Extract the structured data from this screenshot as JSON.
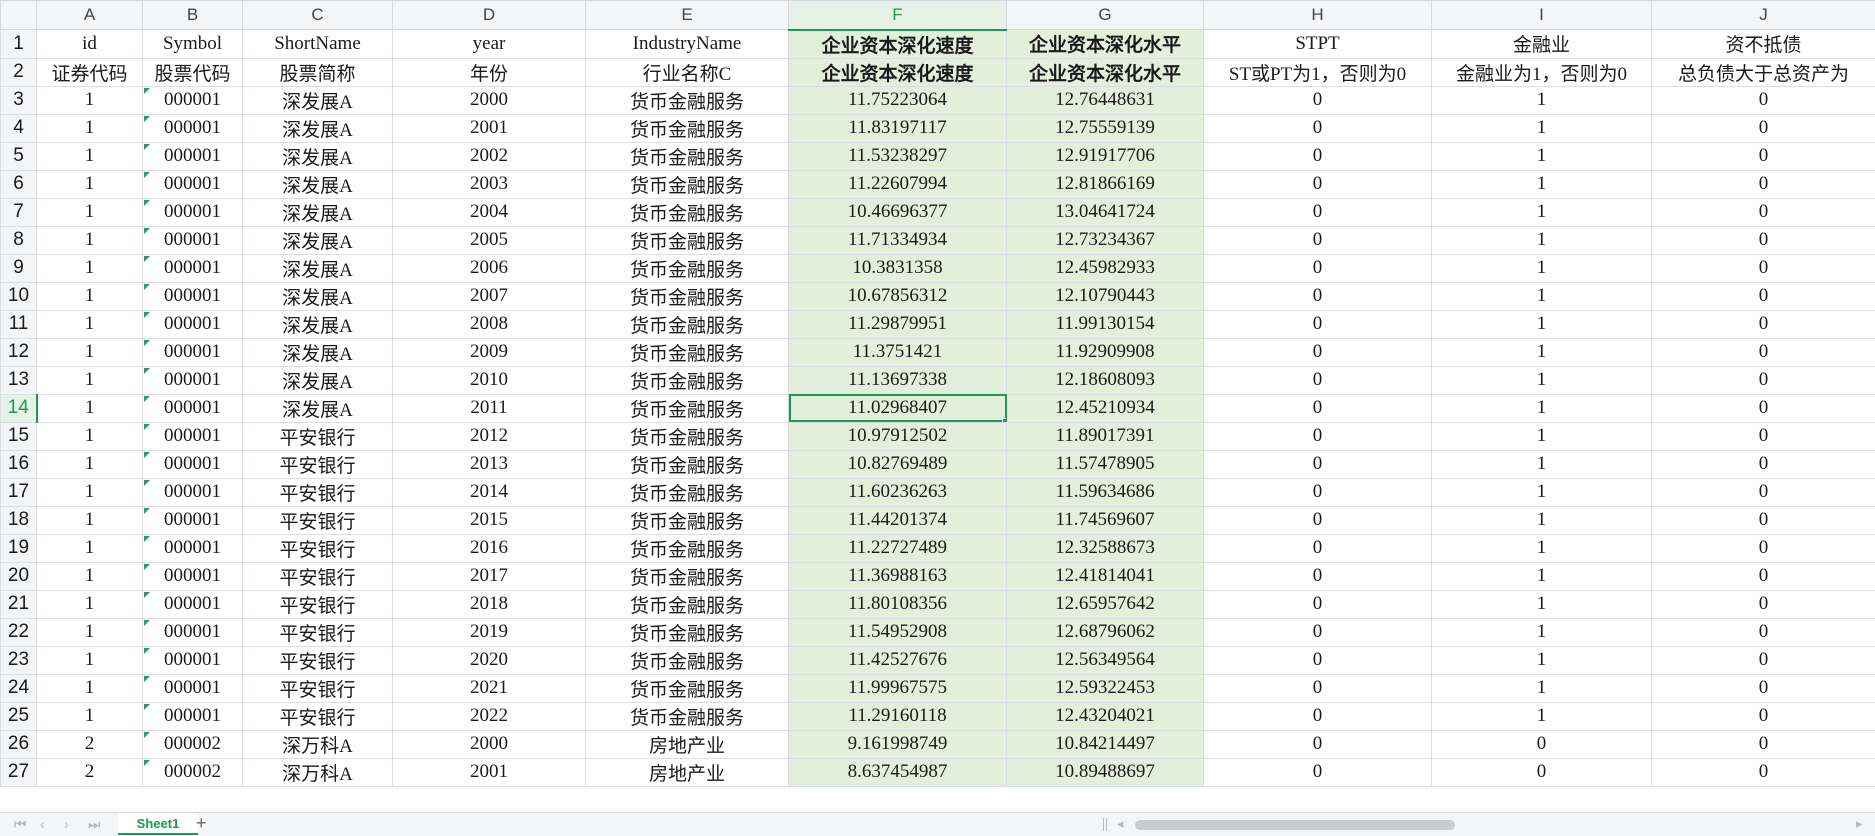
{
  "colors": {
    "accent": "#1e9a4f",
    "highlight": "#e2efda",
    "header_bg": "#f4f5f7"
  },
  "active_cell": "F14",
  "columns": [
    "A",
    "B",
    "C",
    "D",
    "E",
    "F",
    "G",
    "H",
    "I",
    "J"
  ],
  "rows": [
    [
      "1",
      "id",
      "Symbol",
      "ShortName",
      "year",
      "IndustryName",
      "企业资本深化速度",
      "企业资本深化水平",
      "STPT",
      "金融业",
      "资不抵债"
    ],
    [
      "2",
      "证券代码",
      "股票代码",
      "股票简称",
      "年份",
      "行业名称C",
      "企业资本深化速度",
      "企业资本深化水平",
      "ST或PT为1，否则为0",
      "金融业为1，否则为0",
      "总负债大于总资产为"
    ],
    [
      "3",
      "1",
      "000001",
      "深发展A",
      "2000",
      "货币金融服务",
      "11.75223064",
      "12.76448631",
      "0",
      "1",
      "0"
    ],
    [
      "4",
      "1",
      "000001",
      "深发展A",
      "2001",
      "货币金融服务",
      "11.83197117",
      "12.75559139",
      "0",
      "1",
      "0"
    ],
    [
      "5",
      "1",
      "000001",
      "深发展A",
      "2002",
      "货币金融服务",
      "11.53238297",
      "12.91917706",
      "0",
      "1",
      "0"
    ],
    [
      "6",
      "1",
      "000001",
      "深发展A",
      "2003",
      "货币金融服务",
      "11.22607994",
      "12.81866169",
      "0",
      "1",
      "0"
    ],
    [
      "7",
      "1",
      "000001",
      "深发展A",
      "2004",
      "货币金融服务",
      "10.46696377",
      "13.04641724",
      "0",
      "1",
      "0"
    ],
    [
      "8",
      "1",
      "000001",
      "深发展A",
      "2005",
      "货币金融服务",
      "11.71334934",
      "12.73234367",
      "0",
      "1",
      "0"
    ],
    [
      "9",
      "1",
      "000001",
      "深发展A",
      "2006",
      "货币金融服务",
      "10.3831358",
      "12.45982933",
      "0",
      "1",
      "0"
    ],
    [
      "10",
      "1",
      "000001",
      "深发展A",
      "2007",
      "货币金融服务",
      "10.67856312",
      "12.10790443",
      "0",
      "1",
      "0"
    ],
    [
      "11",
      "1",
      "000001",
      "深发展A",
      "2008",
      "货币金融服务",
      "11.29879951",
      "11.99130154",
      "0",
      "1",
      "0"
    ],
    [
      "12",
      "1",
      "000001",
      "深发展A",
      "2009",
      "货币金融服务",
      "11.3751421",
      "11.92909908",
      "0",
      "1",
      "0"
    ],
    [
      "13",
      "1",
      "000001",
      "深发展A",
      "2010",
      "货币金融服务",
      "11.13697338",
      "12.18608093",
      "0",
      "1",
      "0"
    ],
    [
      "14",
      "1",
      "000001",
      "深发展A",
      "2011",
      "货币金融服务",
      "11.02968407",
      "12.45210934",
      "0",
      "1",
      "0"
    ],
    [
      "15",
      "1",
      "000001",
      "平安银行",
      "2012",
      "货币金融服务",
      "10.97912502",
      "11.89017391",
      "0",
      "1",
      "0"
    ],
    [
      "16",
      "1",
      "000001",
      "平安银行",
      "2013",
      "货币金融服务",
      "10.82769489",
      "11.57478905",
      "0",
      "1",
      "0"
    ],
    [
      "17",
      "1",
      "000001",
      "平安银行",
      "2014",
      "货币金融服务",
      "11.60236263",
      "11.59634686",
      "0",
      "1",
      "0"
    ],
    [
      "18",
      "1",
      "000001",
      "平安银行",
      "2015",
      "货币金融服务",
      "11.44201374",
      "11.74569607",
      "0",
      "1",
      "0"
    ],
    [
      "19",
      "1",
      "000001",
      "平安银行",
      "2016",
      "货币金融服务",
      "11.22727489",
      "12.32588673",
      "0",
      "1",
      "0"
    ],
    [
      "20",
      "1",
      "000001",
      "平安银行",
      "2017",
      "货币金融服务",
      "11.36988163",
      "12.41814041",
      "0",
      "1",
      "0"
    ],
    [
      "21",
      "1",
      "000001",
      "平安银行",
      "2018",
      "货币金融服务",
      "11.80108356",
      "12.65957642",
      "0",
      "1",
      "0"
    ],
    [
      "22",
      "1",
      "000001",
      "平安银行",
      "2019",
      "货币金融服务",
      "11.54952908",
      "12.68796062",
      "0",
      "1",
      "0"
    ],
    [
      "23",
      "1",
      "000001",
      "平安银行",
      "2020",
      "货币金融服务",
      "11.42527676",
      "12.56349564",
      "0",
      "1",
      "0"
    ],
    [
      "24",
      "1",
      "000001",
      "平安银行",
      "2021",
      "货币金融服务",
      "11.99967575",
      "12.59322453",
      "0",
      "1",
      "0"
    ],
    [
      "25",
      "1",
      "000001",
      "平安银行",
      "2022",
      "货币金融服务",
      "11.29160118",
      "12.43204021",
      "0",
      "1",
      "0"
    ],
    [
      "26",
      "2",
      "000002",
      "深万科A",
      "2000",
      "房地产业",
      "9.161998749",
      "10.84214497",
      "0",
      "0",
      "0"
    ],
    [
      "27",
      "2",
      "000002",
      "深万科A",
      "2001",
      "房地产业",
      "8.637454987",
      "10.89488697",
      "0",
      "0",
      "0"
    ]
  ],
  "sheet_tab": "Sheet1",
  "add_sheet": "+",
  "nav": [
    "⏮",
    "‹",
    "›",
    "⏭"
  ]
}
